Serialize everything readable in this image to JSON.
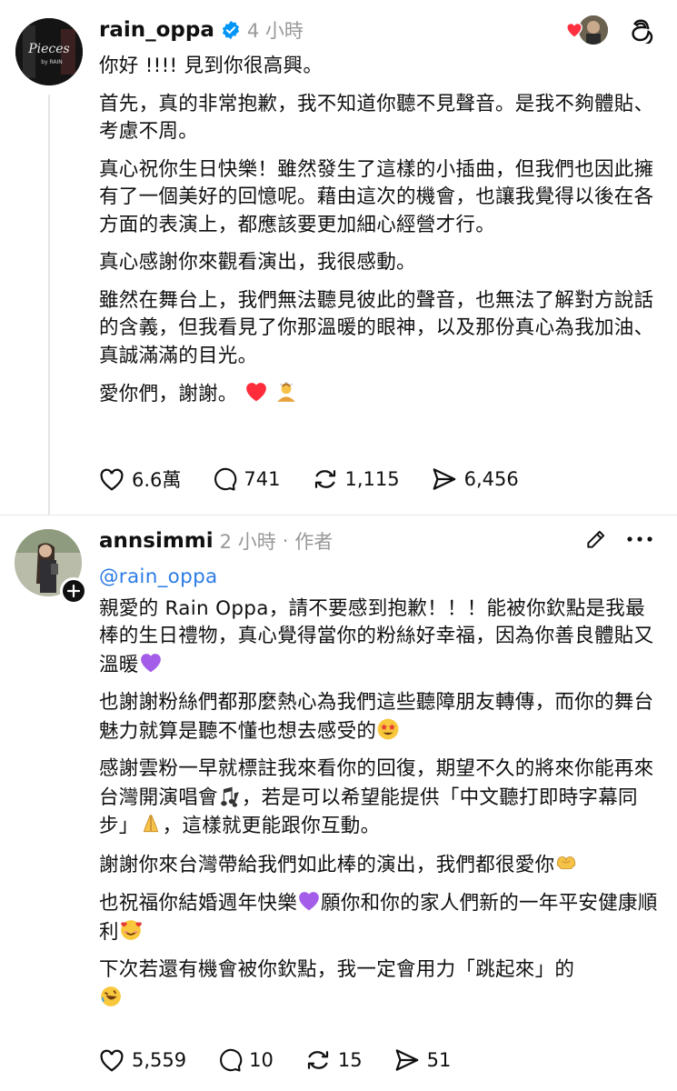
{
  "post1": {
    "username": "rain_oppa",
    "time": "4 小時",
    "avatar_text": "Pieces by RAIN",
    "paragraphs": [
      "你好 !!!! 見到你很高興。",
      "首先，真的非常抱歉，我不知道你聽不見聲音。是我不夠體貼、考慮不周。",
      "真心祝你生日快樂！雖然發生了這樣的小插曲，但我們也因此擁有了一個美好的回憶呢。藉由這次的機會，也讓我覺得以後在各方面的表演上，都應該要更加細心經營才行。",
      "真心感謝你來觀看演出，我很感動。",
      "雖然在舞台上，我們無法聽見彼此的聲音，也無法了解對方說話的含義，但我看見了你那溫暖的眼神，以及那份真心為我加油、真誠滿滿的目光。",
      "愛你們，謝謝。"
    ],
    "likes": "6.6萬",
    "replies": "741",
    "reposts": "1,115",
    "shares": "6,456"
  },
  "post2": {
    "username": "annsimmi",
    "time": "2 小時",
    "role": "作者",
    "mention": "@rain_oppa",
    "p1": "親愛的 Rain Oppa，請不要感到抱歉！！！能被你欽點是我最棒的生日禮物，真心覺得當你的粉絲好幸福，因為你善良體貼又溫暖",
    "p2": "也謝謝粉絲們都那麼熱心為我們這些聽障朋友轉傳，而你的舞台魅力就算是聽不懂也想去感受的",
    "p3a": "感謝雲粉一早就標註我來看你的回復，期望不久的將來你能再來台灣開演唱會",
    "p3b": "，若是可以希望能提供「中文聽打即時字幕同步」",
    "p3c": "，這樣就更能跟你互動。",
    "p4": "謝謝你來台灣帶給我們如此棒的演出，我們都很愛你",
    "p5a": "也祝福你結婚週年快樂",
    "p5b": "願你和你的家人們新的一年平安健康順利",
    "p6": "下次若還有機會被你欽點，我一定會用力「跳起來」的",
    "likes": "5,559",
    "replies": "10",
    "reposts": "15",
    "shares": "51"
  },
  "colors": {
    "verified": "#0095f6",
    "heart": "#ff3040",
    "mention": "#2c7be5",
    "purple_heart": "#a45de8"
  }
}
